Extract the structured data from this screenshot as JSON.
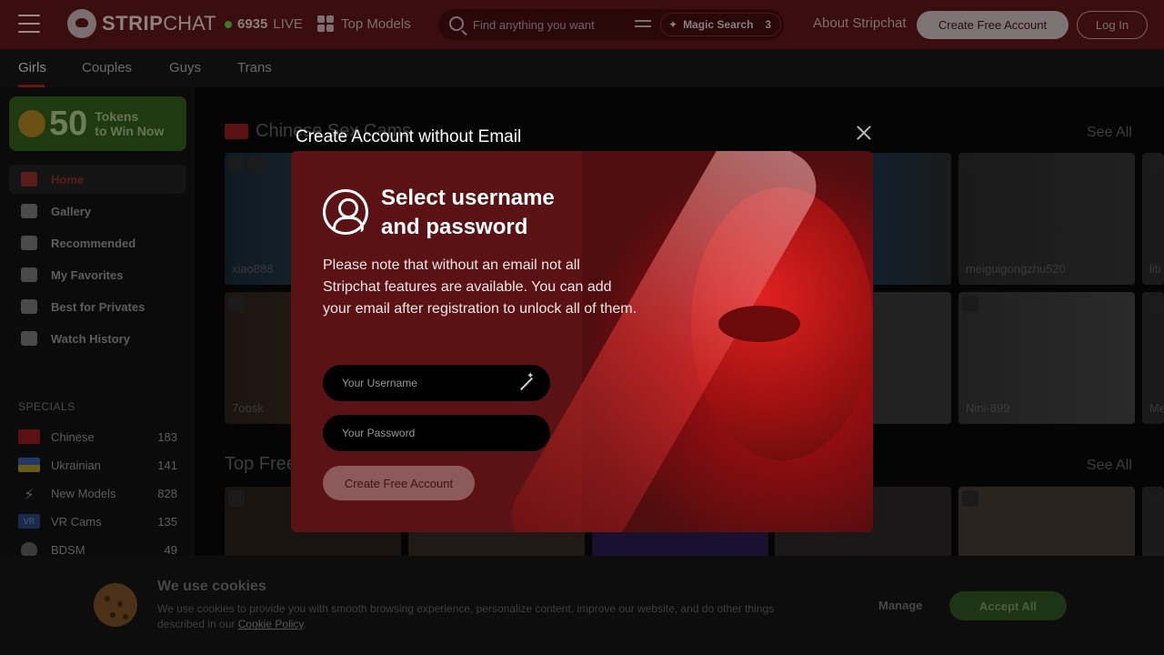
{
  "header": {
    "logo_bold": "STRIP",
    "logo_light": "CHAT",
    "live_count": "6935",
    "live_label": "LIVE",
    "top_models": "Top Models",
    "search_placeholder": "Find anything you want",
    "magic_search": "Magic Search",
    "magic_count": "3",
    "about": "About Stripchat",
    "create_account": "Create Free Account",
    "login": "Log In"
  },
  "tabs": [
    "Girls",
    "Couples",
    "Guys",
    "Trans"
  ],
  "sidebar": {
    "promo_number": "50",
    "promo_line1": "Tokens",
    "promo_line2": "to Win Now",
    "nav": [
      {
        "label": "Home",
        "icon": "home-icon"
      },
      {
        "label": "Gallery",
        "icon": "gallery-icon"
      },
      {
        "label": "Recommended",
        "icon": "thumbs-up-icon"
      },
      {
        "label": "My Favorites",
        "icon": "heart-icon"
      },
      {
        "label": "Best for Privates",
        "icon": "chat-icon"
      },
      {
        "label": "Watch History",
        "icon": "history-icon"
      }
    ],
    "specials_heading": "SPECIALS",
    "specials": [
      {
        "label": "Chinese",
        "count": "183",
        "icon": "china-flag-icon"
      },
      {
        "label": "Ukrainian",
        "count": "141",
        "icon": "ukraine-flag-icon"
      },
      {
        "label": "New Models",
        "count": "828",
        "icon": "lightning-icon"
      },
      {
        "label": "VR Cams",
        "count": "135",
        "icon": "vr-icon"
      },
      {
        "label": "BDSM",
        "count": "49",
        "icon": "bunny-icon"
      }
    ]
  },
  "content": {
    "section1_title": "Chinese Sex Cams",
    "section2_title": "Top Free",
    "see_all": "See All",
    "row1_names": [
      "xiao888",
      "",
      "",
      "",
      "meiguigongzhu520",
      "liti"
    ],
    "row2_names": [
      "7oosk",
      "",
      "",
      "",
      "Nini-899",
      "Me"
    ]
  },
  "modal": {
    "title": "Create Account without Email",
    "heading_line1": "Select username",
    "heading_line2": "and password",
    "note": "Please note that without an email not all Stripchat features are available. You can add your email after registration to unlock all of them.",
    "username_placeholder": "Your Username",
    "password_placeholder": "Your Password",
    "submit": "Create Free Account"
  },
  "cookies": {
    "heading": "We use cookies",
    "text": "We use cookies to provide you with smooth browsing experience, personalize content, improve our website, and do other things described in our",
    "link": "Cookie Policy",
    "manage": "Manage",
    "accept": "Accept All"
  }
}
